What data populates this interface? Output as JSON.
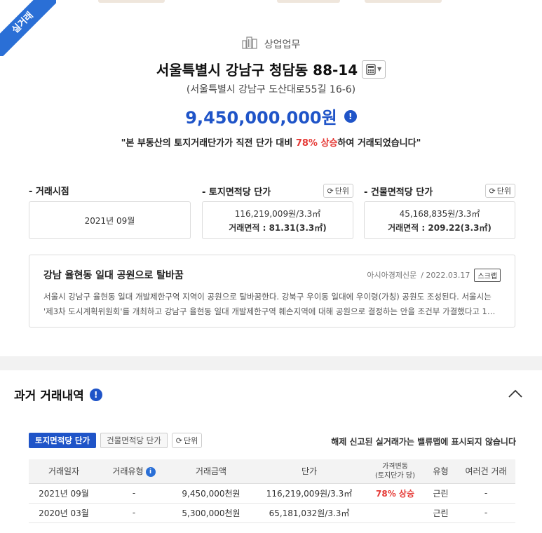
{
  "ribbon": {
    "label": "실거래"
  },
  "property": {
    "category": "상업업무",
    "address": "서울특별시 강남구 청담동 88-14",
    "road_address": "(서울특별시 강남구 도산대로55길 16-6)",
    "price": "9,450,000,000원",
    "notice_pre": "\"본 부동산의 토지거래단가가 직전 단가 대비 ",
    "notice_highlight": "78% 상승",
    "notice_post": "하여 거래되었습니다\""
  },
  "metrics": {
    "unit_label": "단위",
    "deal_date": {
      "title": "- 거래시점",
      "value": "2021년 09월"
    },
    "land": {
      "title": "- 토지면적당 단가",
      "price": "116,219,009원/3.3㎡",
      "area": "거래면적 : 81.31(3.3㎡)"
    },
    "building": {
      "title": "- 건물면적당 단가",
      "price": "45,168,835원/3.3㎡",
      "area": "거래면적 : 209.22(3.3㎡)"
    }
  },
  "news": {
    "title": "강남 율현동 일대 공원으로 탈바꿈",
    "source": "아시아경제신문",
    "date": "/ 2022.03.17",
    "scrap_label": "스크랩",
    "line1": "서울시 강남구 율현동 일대 개발제한구역 지역이 공원으로 탈바꿈한다. 강북구 우이동 일대에 우이령(가칭) 공원도 조성된다. 서울시는",
    "line2": "'제3차 도시계획위원회'를 개최하고 강남구 율현동 일대 개발제한구역 훼손지역에 대해 공원으로 결정하는 안을 조건부 가결했다고 1…"
  },
  "history": {
    "title": "과거 거래내역",
    "tabs": [
      "토지면적당 단가",
      "건물면적당 단가"
    ],
    "unit_label": "단위",
    "note": "해제 신고된 실거래가는 밸류맵에 표시되지 않습니다",
    "columns": {
      "date": "거래일자",
      "type": "거래유형",
      "amount": "거래금액",
      "unit_price": "단가",
      "change_line1": "가격변동",
      "change_line2": "(토지단가 당)",
      "kind": "유형",
      "multi": "여러건 거래"
    },
    "rows": [
      {
        "date": "2021년 09월",
        "type": "-",
        "amount": "9,450,000천원",
        "unit_price": "116,219,009원/3.3㎡",
        "change": "78% 상승",
        "kind": "근린",
        "multi": "-"
      },
      {
        "date": "2020년 03월",
        "type": "-",
        "amount": "5,300,000천원",
        "unit_price": "65,181,032원/3.3㎡",
        "change": "",
        "kind": "근린",
        "multi": "-"
      }
    ]
  }
}
